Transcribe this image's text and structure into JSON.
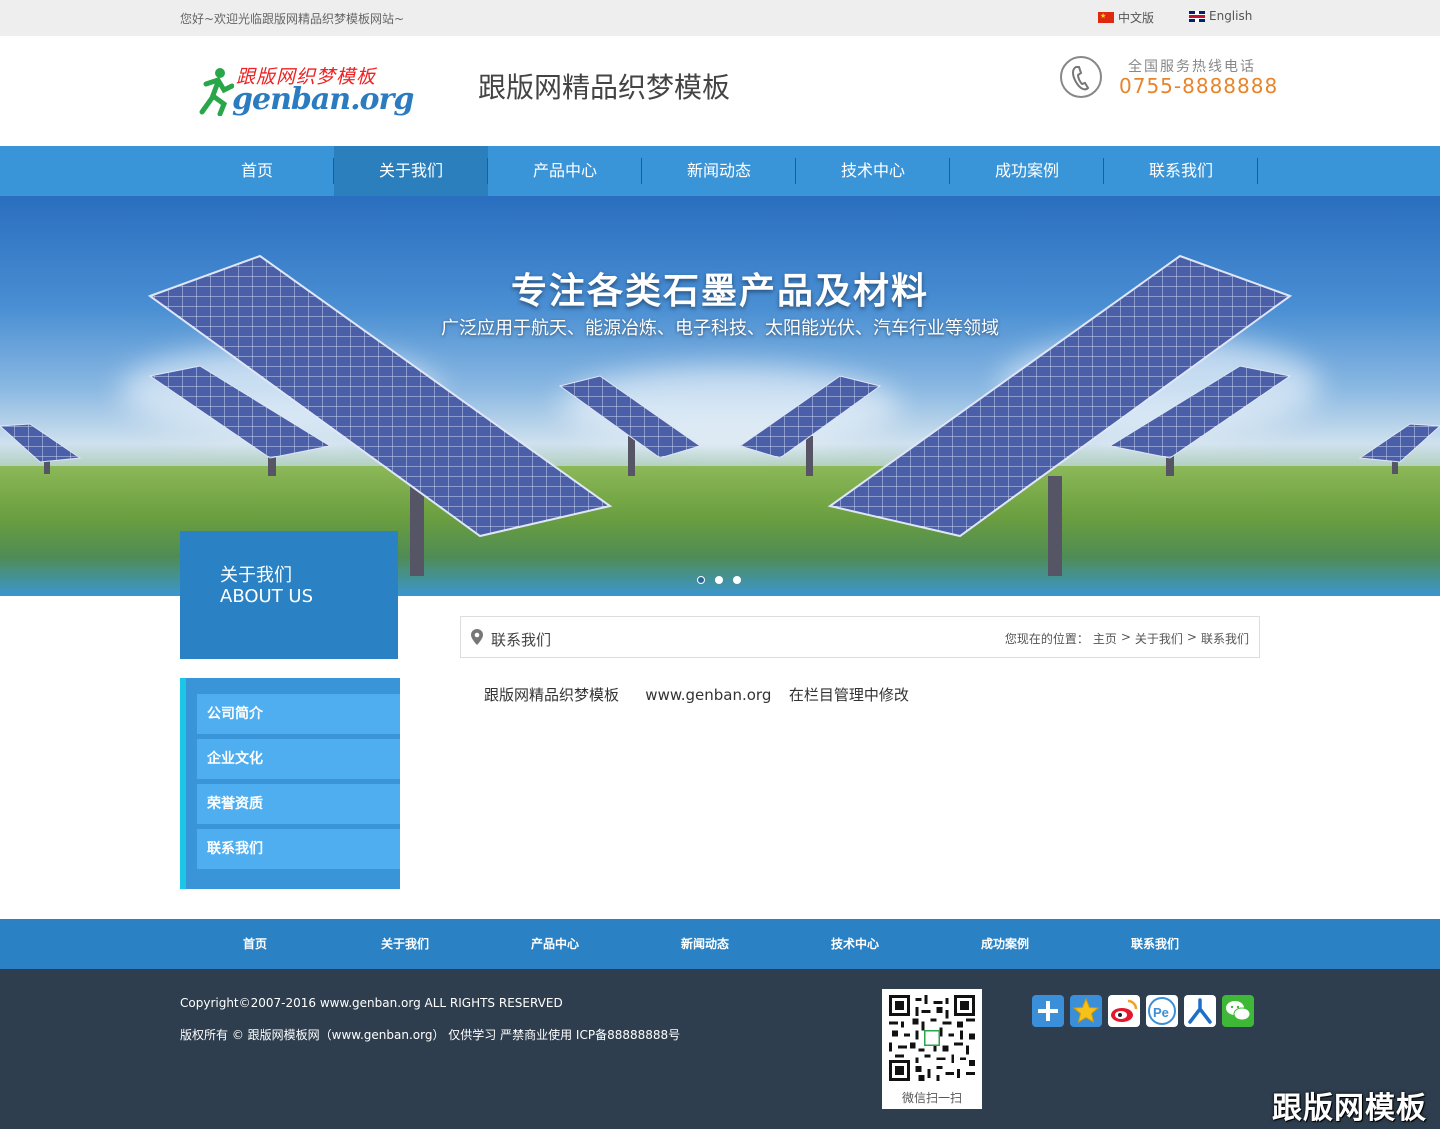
{
  "topbar": {
    "welcome": "您好~欢迎光临跟版网精品织梦模板网站~",
    "lang_cn": "中文版",
    "lang_en": "English"
  },
  "header": {
    "logo_cn": "跟版网织梦模板",
    "logo_en": "genban.org",
    "site_name": "跟版网精品织梦模板",
    "hotline_label": "全国服务热线电话",
    "hotline_number": "0755-8888888"
  },
  "nav": {
    "items": [
      "首页",
      "关于我们",
      "产品中心",
      "新闻动态",
      "技术中心",
      "成功案例",
      "联系我们"
    ],
    "active_index": 1
  },
  "banner": {
    "title": "专注各类石墨产品及材料",
    "subtitle": "广泛应用于航天、能源冶炼、电子科技、太阳能光伏、汽车行业等领域",
    "slide_count": 3,
    "active_slide": 0
  },
  "sidebar": {
    "title_cn": "关于我们",
    "title_en": "ABOUT US",
    "items": [
      "公司简介",
      "企业文化",
      "荣誉资质",
      "联系我们"
    ]
  },
  "content": {
    "section_title": "联系我们",
    "location_label": "您现在的位置：",
    "crumbs": [
      "主页",
      "关于我们",
      "联系我们"
    ],
    "crumb_sep": ">",
    "body": "跟版网精品织梦模板   www.genban.org  在栏目管理中修改"
  },
  "footer_nav": {
    "items": [
      "首页",
      "关于我们",
      "产品中心",
      "新闻动态",
      "技术中心",
      "成功案例",
      "联系我们"
    ]
  },
  "footer": {
    "copyright": "Copyright©2007-2016 www.genban.org ALL RIGHTS RESERVED",
    "rights": "版权所有 © 跟版网模板网（www.genban.org） 仅供学习 严禁商业使用 ICP备88888888号",
    "qr_label": "微信扫一扫",
    "share_icons": [
      "plus-share-icon",
      "qzone-star-icon",
      "weibo-icon",
      "tencent-weibo-icon",
      "renren-icon",
      "wechat-icon"
    ]
  },
  "watermark": "跟版网模板",
  "colors": {
    "nav": "#3a95d8",
    "nav_active": "#2b7fbc",
    "footer": "#2e3e4e",
    "hotline": "#e8842a",
    "sidebar_item": "#4eaef0"
  }
}
